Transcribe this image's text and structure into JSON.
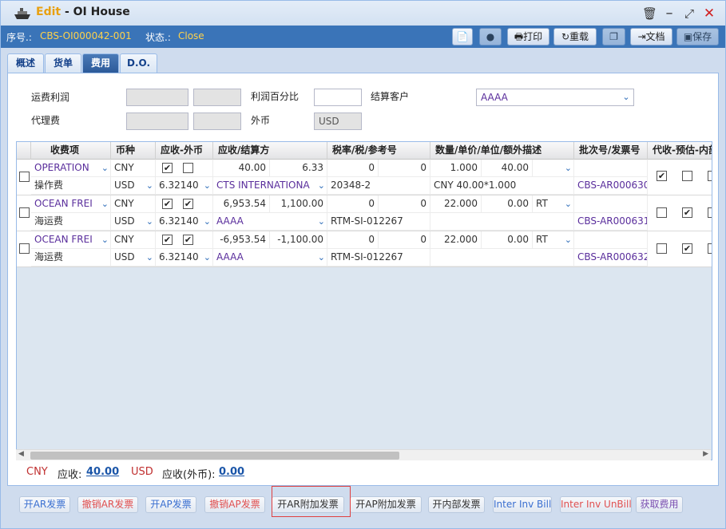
{
  "window": {
    "title_prefix": "Edit",
    "title_sep": " - ",
    "title_main": "OI House",
    "icons": [
      "trash-icon",
      "minimize-icon",
      "maximize-icon",
      "close-icon"
    ]
  },
  "info": {
    "seq_label": "序号.:",
    "seq_value": "CBS-OI000042-001",
    "status_label": "状态.:",
    "status_value": "Close"
  },
  "toolbar": {
    "print": "打印",
    "reload": "重载",
    "doc": "文档",
    "save": "保存"
  },
  "tabs": [
    "概述",
    "货单",
    "费用",
    "D.O."
  ],
  "active_tab": "费用",
  "form": {
    "freight_profit_label": "运费利润",
    "profit_pct_label": "利润百分比",
    "settle_customer_label": "结算客户",
    "settle_customer_value": "AAAA",
    "agent_fee_label": "代理费",
    "foreign_label": "外币",
    "foreign_value": "USD"
  },
  "grid": {
    "headers": [
      "收费项",
      "币种",
      "应收-外币",
      "应收/结算方",
      "税率/税/参考号",
      "数量/单价/单位/额外描述",
      "批次号/发票号",
      "代收-预估-内部"
    ],
    "rows": [
      {
        "charge": "OPERATION",
        "charge_cn": "操作费",
        "cur": "CNY",
        "cur2": "USD",
        "chk1": true,
        "chk2": false,
        "rate": "6.32140",
        "amt": "40.00",
        "amt2": "6.33",
        "party": "CTS INTERNATIONA",
        "tax1": "0",
        "tax2": "0",
        "ref": "20348-2",
        "qty": "1.000",
        "price": "40.00",
        "unit": "",
        "desc": "CNY 40.00*1.000",
        "inv": "CBS-AR000630",
        "f1": true,
        "f2": false,
        "f3": false
      },
      {
        "charge": "OCEAN FREI",
        "charge_cn": "海运费",
        "cur": "CNY",
        "cur2": "USD",
        "chk1": true,
        "chk2": true,
        "rate": "6.32140",
        "amt": "6,953.54",
        "amt2": "1,100.00",
        "party": "AAAA",
        "tax1": "0",
        "tax2": "0",
        "ref": "RTM-SI-012267",
        "qty": "22.000",
        "price": "0.00",
        "unit": "RT",
        "desc": "",
        "inv": "CBS-AR000631",
        "f1": false,
        "f2": true,
        "f3": false
      },
      {
        "charge": "OCEAN FREI",
        "charge_cn": "海运费",
        "cur": "CNY",
        "cur2": "USD",
        "chk1": true,
        "chk2": true,
        "rate": "6.32140",
        "amt": "-6,953.54",
        "amt2": "-1,100.00",
        "party": "AAAA",
        "tax1": "0",
        "tax2": "0",
        "ref": "RTM-SI-012267",
        "qty": "22.000",
        "price": "0.00",
        "unit": "RT",
        "desc": "",
        "inv": "CBS-AR000632",
        "f1": false,
        "f2": true,
        "f3": false
      }
    ]
  },
  "totals": {
    "cur1": "CNY",
    "ar_label": "应收:",
    "ar_value": "40.00",
    "cur2": "USD",
    "ar_fx_label": "应收(外币):",
    "ar_fx_value": "0.00"
  },
  "buttons": [
    {
      "label": "开AR发票",
      "color": "#3a6fd0"
    },
    {
      "label": "撤销AR发票",
      "color": "#e05050"
    },
    {
      "label": "开AP发票",
      "color": "#3a6fd0"
    },
    {
      "label": "撤销AP发票",
      "color": "#e05050"
    },
    {
      "label": "开AR附加发票",
      "color": "#333333"
    },
    {
      "label": "开AP附加发票",
      "color": "#333333"
    },
    {
      "label": "开内部发票",
      "color": "#333333"
    },
    {
      "label": "Inter Inv Bill",
      "color": "#3a6fd0"
    },
    {
      "label": "Inter Inv UnBill",
      "color": "#e05050"
    },
    {
      "label": "获取费用",
      "color": "#7a4fb0"
    }
  ],
  "colors": {
    "accent": "#3a74b8",
    "status": "#ffd24a",
    "purple": "#5a2e9c"
  }
}
